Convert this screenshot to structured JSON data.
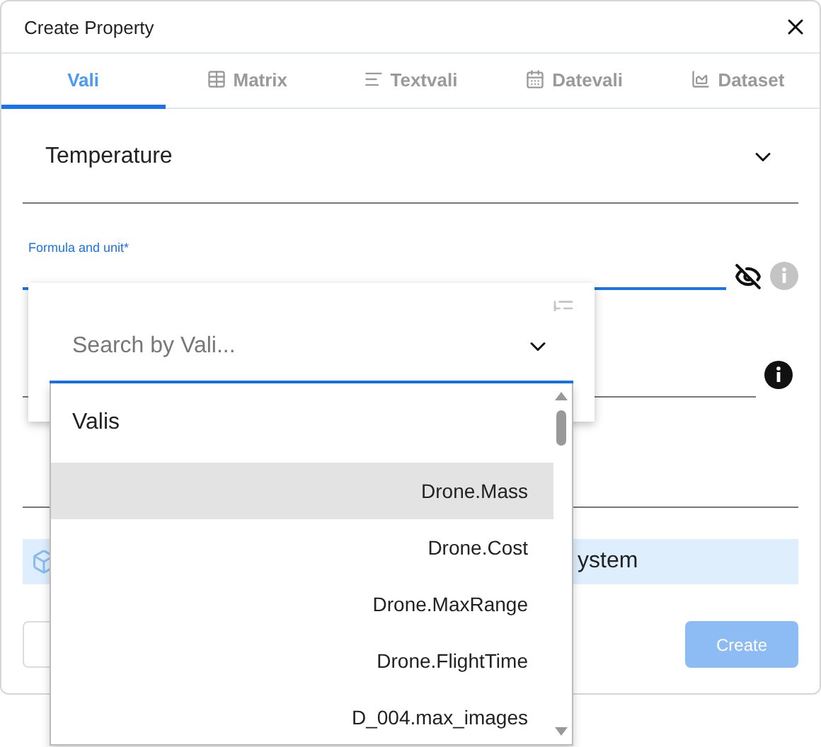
{
  "dialog": {
    "title": "Create Property"
  },
  "tabs": [
    {
      "label": "Vali",
      "kind": "plain",
      "selected": true
    },
    {
      "label": "Matrix",
      "kind": "table",
      "selected": false
    },
    {
      "label": "Textvali",
      "kind": "text",
      "selected": false
    },
    {
      "label": "Datevali",
      "kind": "calendar",
      "selected": false
    },
    {
      "label": "Dataset",
      "kind": "chart",
      "selected": false
    }
  ],
  "category_select": {
    "value": "Temperature"
  },
  "formula_field": {
    "label": "Formula and unit*"
  },
  "banner": {
    "text": "ystem"
  },
  "buttons": [
    {
      "kind": "outline"
    },
    {
      "label": "Create",
      "kind": "primary",
      "disabled": true
    }
  ],
  "vali_picker": {
    "placeholder": "Search by Vali...",
    "list_header": "Valis",
    "items": [
      {
        "label": "Drone.Mass",
        "selected": true
      },
      {
        "label": "Drone.Cost",
        "selected": false
      },
      {
        "label": "Drone.MaxRange",
        "selected": false
      },
      {
        "label": "Drone.FlightTime",
        "selected": false
      },
      {
        "label": "D_004.max_images",
        "selected": false
      }
    ]
  }
}
